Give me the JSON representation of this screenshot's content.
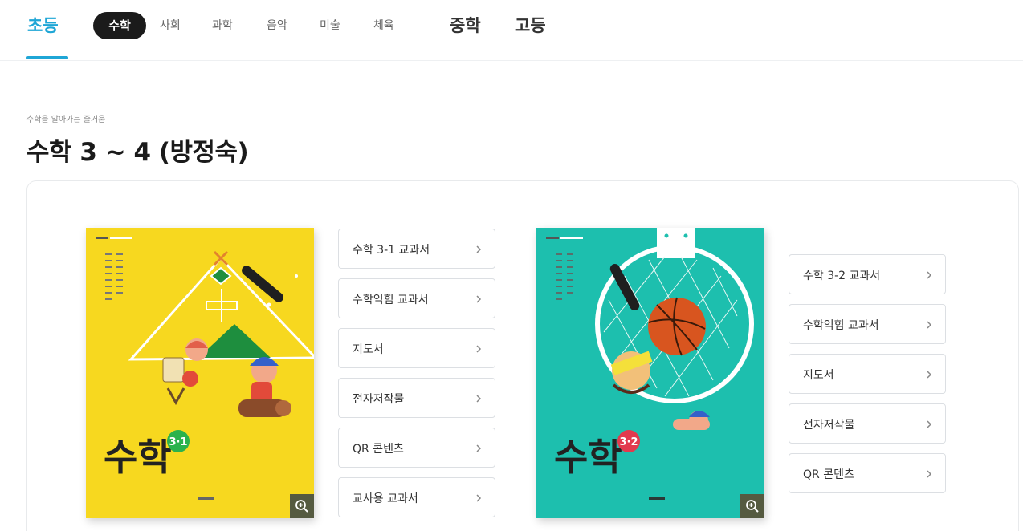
{
  "nav": {
    "level_elementary": "초등",
    "subjects": [
      "수학",
      "사회",
      "과학",
      "음악",
      "미술",
      "체육"
    ],
    "level_middle": "중학",
    "level_high": "고등"
  },
  "header": {
    "subtitle": "수학을 알아가는 즐거움",
    "title": "수학 3 ~ 4 (방정숙)"
  },
  "books": [
    {
      "cover_title": "수학",
      "badge": "3-1",
      "badge_display": "3·1",
      "cover_color": "#f7d81f",
      "badge_color": "#2bb24c",
      "menu": [
        "수학 3-1 교과서",
        "수학익힘 교과서",
        "지도서",
        "전자저작물",
        "QR 콘텐츠",
        "교사용 교과서"
      ]
    },
    {
      "cover_title": "수학",
      "badge": "3-2",
      "badge_display": "3·2",
      "cover_color": "#1dbfae",
      "badge_color": "#e23a4e",
      "menu": [
        "수학 3-2 교과서",
        "수학익힘 교과서",
        "지도서",
        "전자저작물",
        "QR 콘텐츠"
      ]
    }
  ],
  "icons": {
    "zoom": "zoom-in-icon",
    "chevron": "chevron-right-icon"
  },
  "colors": {
    "accent": "#1fa6d6",
    "pill": "#1b1b1b"
  }
}
